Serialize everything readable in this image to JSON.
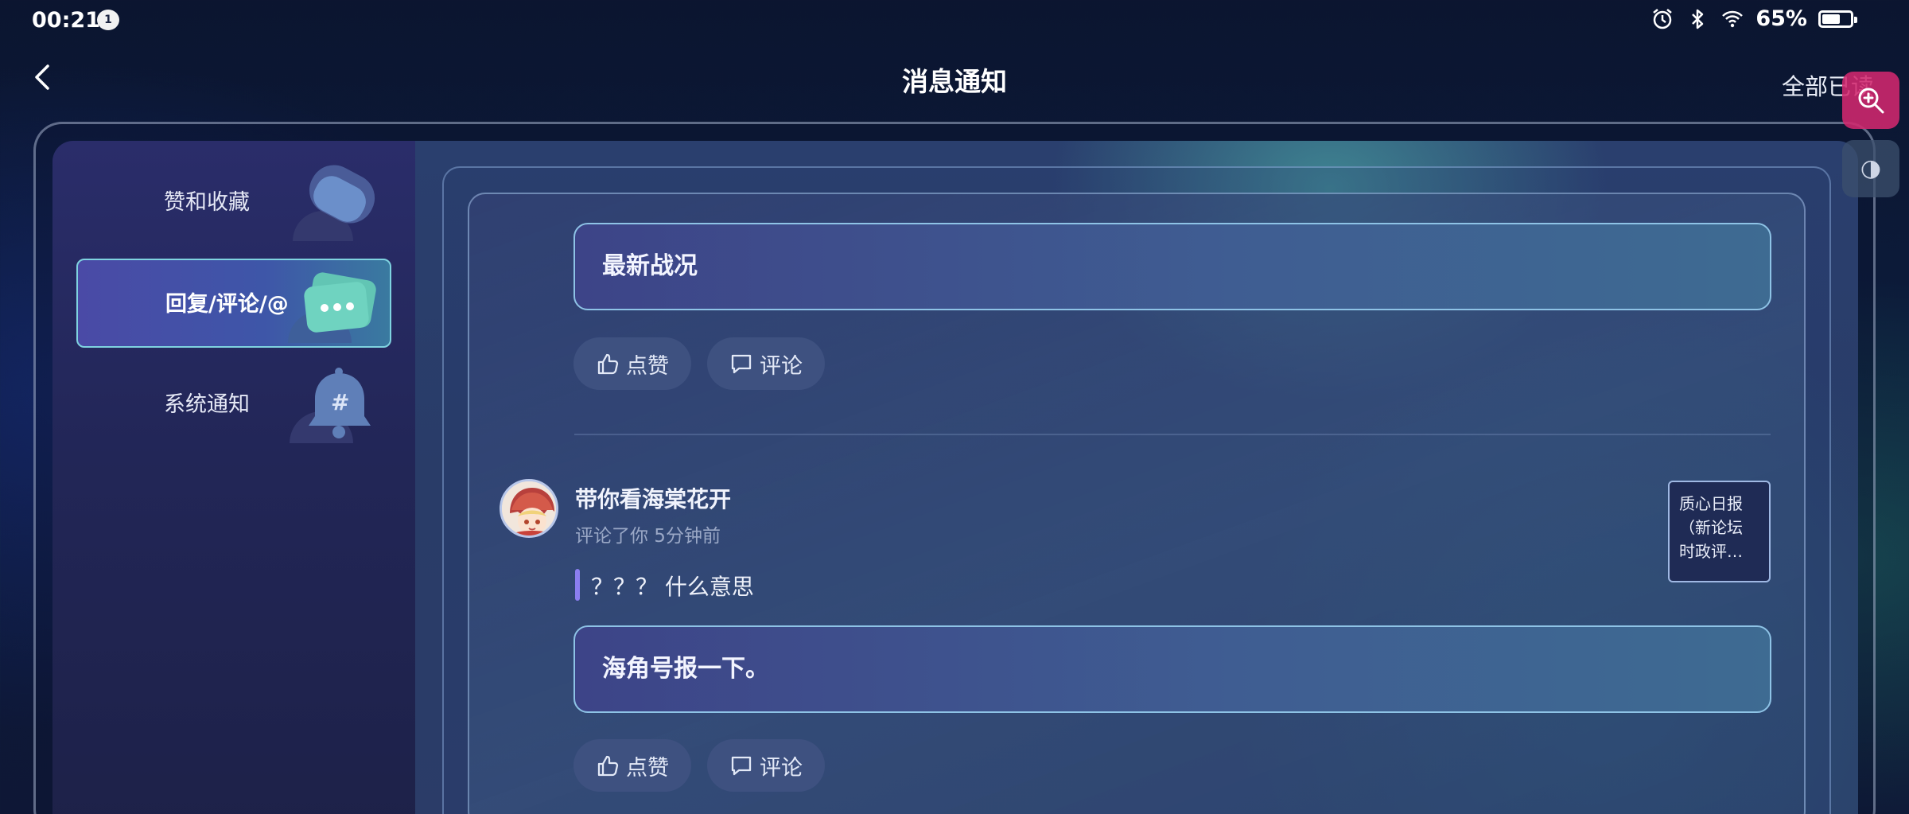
{
  "status_bar": {
    "time": "00:21",
    "notification_count": "1",
    "battery_percent": "65%",
    "battery_level": 0.65
  },
  "header": {
    "title": "消息通知",
    "mark_all_read": "全部已读"
  },
  "sidebar": {
    "items": [
      {
        "label": "赞和收藏",
        "icon": "heart-bubble-icon",
        "active": false
      },
      {
        "label": "回复/评论/@",
        "icon": "chat-bubble-icon",
        "active": true
      },
      {
        "label": "系统通知",
        "icon": "bell-icon",
        "active": false
      }
    ]
  },
  "notifications": [
    {
      "quoted_post": "最新战况",
      "like_label": "点赞",
      "comment_label": "评论"
    },
    {
      "user": "带你看海棠花开",
      "meta": "评论了你 5分钟前",
      "comment": "？？？ 什么意思",
      "source_lines": [
        "质心日报",
        "（新论坛",
        "时政评…"
      ],
      "quoted_post": "海角号报一下。",
      "like_label": "点赞",
      "comment_label": "评论"
    }
  ],
  "colors": {
    "accent_active_border": "#7fd3e0",
    "quote_bar": "#8b7ef0",
    "zoom_widget": "#d2286e"
  }
}
